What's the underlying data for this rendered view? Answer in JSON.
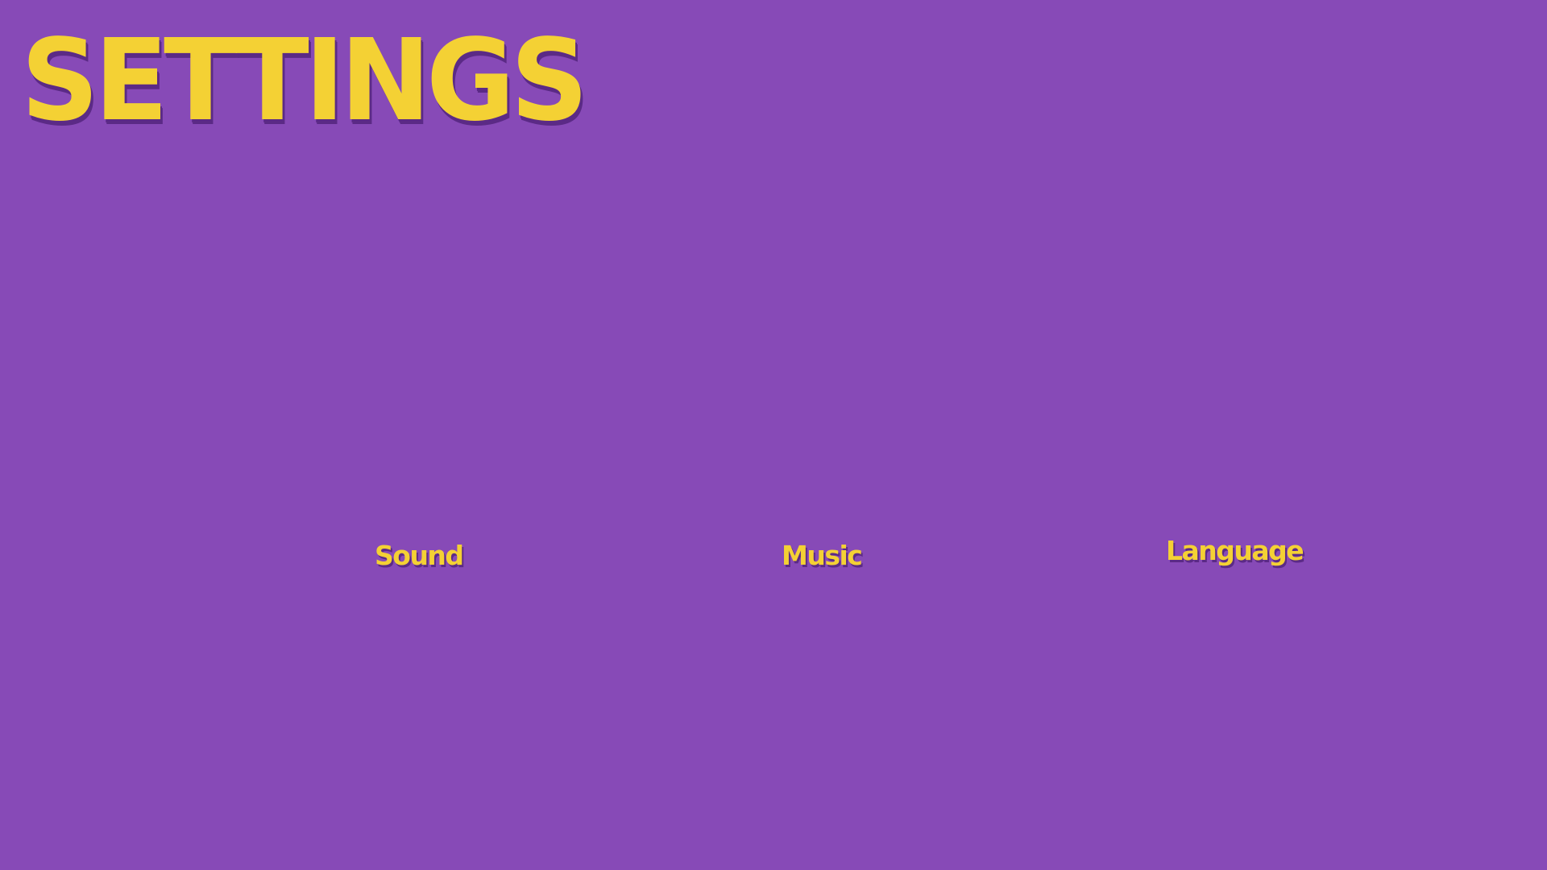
{
  "screen": {
    "title": "SETTINGS",
    "background_color": "#874AB7",
    "text_color": "#F4D134",
    "shadow_color": "#5B2A86"
  },
  "options": [
    {
      "label": "Sound"
    },
    {
      "label": "Music"
    },
    {
      "label": "Language"
    }
  ]
}
